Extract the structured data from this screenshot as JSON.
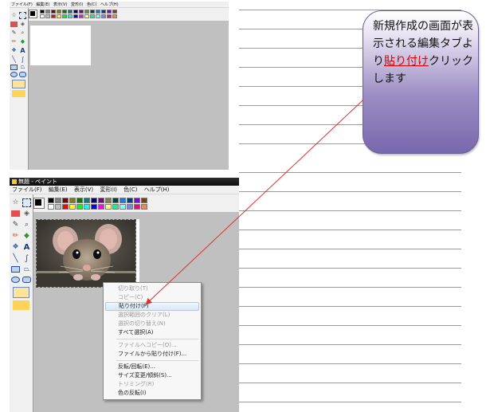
{
  "top_window": {
    "menu": [
      "ファイル(F)",
      "編集(E)",
      "表示(V)",
      "変形(I)",
      "色(C)",
      "ヘルプ(H)"
    ]
  },
  "bottom_window": {
    "title": "無題 - ペイント",
    "menu": [
      "ファイル(F)",
      "編集(E)",
      "表示(V)",
      "変形(I)",
      "色(C)",
      "ヘルプ(H)"
    ],
    "image_caption": "mouse-photo"
  },
  "context_menu": {
    "items": [
      {
        "label": "切り取り(T)",
        "enabled": false
      },
      {
        "label": "コピー(C)",
        "enabled": false
      },
      {
        "label": "貼り付け(P)",
        "enabled": true,
        "highlighted": true
      },
      {
        "label": "選択範囲のクリア(L)",
        "enabled": false
      },
      {
        "label": "選択の切り替え(N)",
        "enabled": false
      },
      {
        "label": "すべて選択(A)",
        "enabled": true
      },
      {
        "label": "ファイルへコピー(O)...",
        "enabled": false
      },
      {
        "label": "ファイルから貼り付け(F)...",
        "enabled": true
      },
      {
        "label": "反転/回転(E)...",
        "enabled": true
      },
      {
        "label": "サイズ変更/傾斜(S)...",
        "enabled": true
      },
      {
        "label": "トリミング(R)",
        "enabled": false
      },
      {
        "label": "色の反転(I)",
        "enabled": true
      }
    ]
  },
  "callout": {
    "text_before": "新規作成の画面が表示される編集タブより",
    "text_highlight": "貼り付け",
    "text_after": "クリックします"
  },
  "palette_colors": [
    "#000000",
    "#808080",
    "#800000",
    "#808000",
    "#008000",
    "#008080",
    "#000080",
    "#800080",
    "#808040",
    "#004040",
    "#0080ff",
    "#004080",
    "#8000ff",
    "#804000",
    "#ffffff",
    "#c0c0c0",
    "#ff0000",
    "#ffff00",
    "#00ff00",
    "#00ffff",
    "#0000ff",
    "#ff00ff",
    "#ffff80",
    "#00ff80",
    "#80ffff",
    "#8080ff",
    "#ff0080",
    "#ff8040"
  ],
  "colors": {
    "arrow": "#e03030",
    "bubble": "#8c7dbd",
    "highlight_text": "#e00000"
  }
}
